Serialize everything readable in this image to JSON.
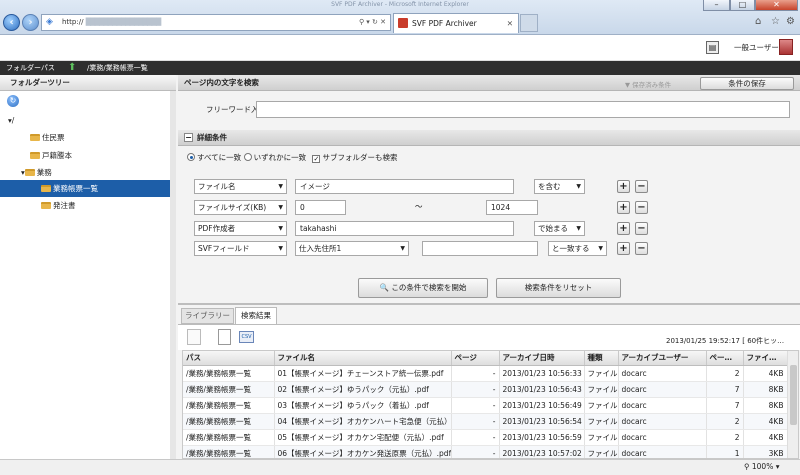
{
  "browser": {
    "url": "http://",
    "tab_title": "SVF PDF Archiver",
    "window_title": "SVF PDF Archiver - Microsoft Internet Explorer",
    "zoom": "100%"
  },
  "app": {
    "user": "一般ユーザー"
  },
  "path": {
    "label": "フォルダーパス",
    "value": "/業務/業務帳票一覧"
  },
  "tree": {
    "title": "フォルダーツリー",
    "root": "/",
    "items": [
      {
        "label": "住民票"
      },
      {
        "label": "戸籍謄本"
      },
      {
        "label": "業務"
      },
      {
        "label": "業務帳票一覧"
      },
      {
        "label": "発注書"
      }
    ]
  },
  "search": {
    "title": "ページ内の文字を検索",
    "load_label": "▼ 保存済み条件",
    "save_label": "条件の保存",
    "free_label": "フリーワード入力",
    "free_value": ""
  },
  "detail": {
    "title": "詳細条件",
    "radio_all": "すべてに一致",
    "radio_any": "いずれかに一致",
    "subfolder": "サブフォルダーも検索",
    "rows": [
      {
        "field": "ファイル名",
        "value": "イメージ",
        "op": "を含む"
      },
      {
        "field": "ファイルサイズ(KB)",
        "value": "0",
        "tilde": "～",
        "value2": "1024"
      },
      {
        "field": "PDF作成者",
        "value": "takahashi",
        "op": "で始まる"
      },
      {
        "field": "SVFフィールド",
        "value": "仕入先住所1",
        "value2": "",
        "op": "と一致する"
      }
    ],
    "search_btn": "この条件で検索を開始",
    "reset_btn": "検索条件をリセット"
  },
  "results": {
    "tabs": [
      "ライブラリー",
      "検索結果"
    ],
    "info": "2013/01/25 19:52:17 [ 60件ヒッ…",
    "columns": [
      "パス",
      "ファイル名",
      "ページ",
      "アーカイブ日時",
      "種類",
      "アーカイブユーザー",
      "ペー…",
      "ファイ…"
    ],
    "rows": [
      [
        "/業務/業務帳票一覧",
        "01【帳票イメージ】チェーンストア統一伝票.pdf",
        "-",
        "2013/01/23 10:56:33",
        "ファイル",
        "docarc",
        "2",
        "4KB"
      ],
      [
        "/業務/業務帳票一覧",
        "02【帳票イメージ】ゆうパック（元払）.pdf",
        "-",
        "2013/01/23 10:56:43",
        "ファイル",
        "docarc",
        "7",
        "8KB"
      ],
      [
        "/業務/業務帳票一覧",
        "03【帳票イメージ】ゆうパック（着払）.pdf",
        "-",
        "2013/01/23 10:56:49",
        "ファイル",
        "docarc",
        "7",
        "8KB"
      ],
      [
        "/業務/業務帳票一覧",
        "04【帳票イメージ】オカケンハート宅急便（元払）.pdf",
        "-",
        "2013/01/23 10:56:54",
        "ファイル",
        "docarc",
        "2",
        "4KB"
      ],
      [
        "/業務/業務帳票一覧",
        "05【帳票イメージ】オカケン宅配便（元払）.pdf",
        "-",
        "2013/01/23 10:56:59",
        "ファイル",
        "docarc",
        "2",
        "4KB"
      ],
      [
        "/業務/業務帳票一覧",
        "06【帳票イメージ】オカケン発送原票（元払）.pdf",
        "-",
        "2013/01/23 10:57:02",
        "ファイル",
        "docarc",
        "1",
        "3KB"
      ]
    ]
  }
}
